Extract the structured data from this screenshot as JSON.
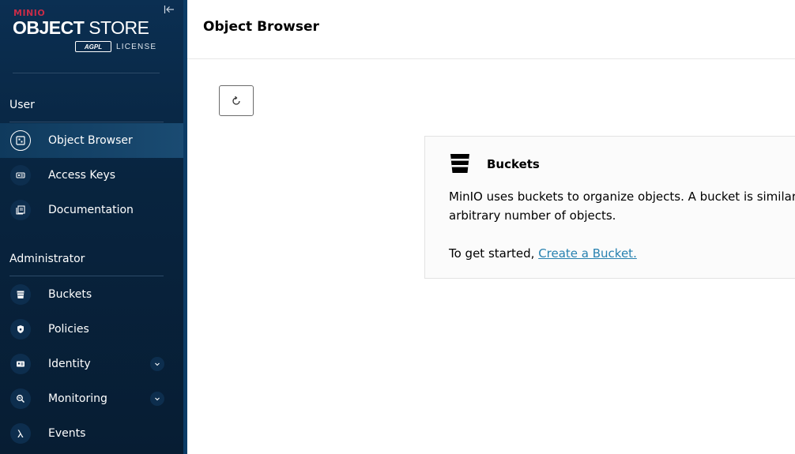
{
  "brand": {
    "minio": "MINIO",
    "title_bold": "OBJECT",
    "title_light": "STORE",
    "badge": "AGPL",
    "license": "LICENSE"
  },
  "sidebar": {
    "sections": {
      "user": "User",
      "admin": "Administrator"
    },
    "user_items": [
      {
        "label": "Object Browser",
        "icon": "object-browser-icon",
        "active": true
      },
      {
        "label": "Access Keys",
        "icon": "access-keys-icon"
      },
      {
        "label": "Documentation",
        "icon": "documentation-icon"
      }
    ],
    "admin_items": [
      {
        "label": "Buckets",
        "icon": "buckets-icon"
      },
      {
        "label": "Policies",
        "icon": "policies-icon"
      },
      {
        "label": "Identity",
        "icon": "identity-icon",
        "expandable": true
      },
      {
        "label": "Monitoring",
        "icon": "monitoring-icon",
        "expandable": true
      },
      {
        "label": "Events",
        "icon": "events-icon"
      }
    ]
  },
  "header": {
    "title": "Object Browser"
  },
  "help_box": {
    "title": "Buckets",
    "text_line1": "MinIO uses buckets to organize objects. A bucket is similar",
    "text_line2": "arbitrary number of objects.",
    "start_prefix": "To get started, ",
    "start_link": "Create a Bucket."
  },
  "colors": {
    "sidebar_bg": "#0b2f52",
    "brand_red": "#c72c48",
    "link": "#2781b0"
  }
}
